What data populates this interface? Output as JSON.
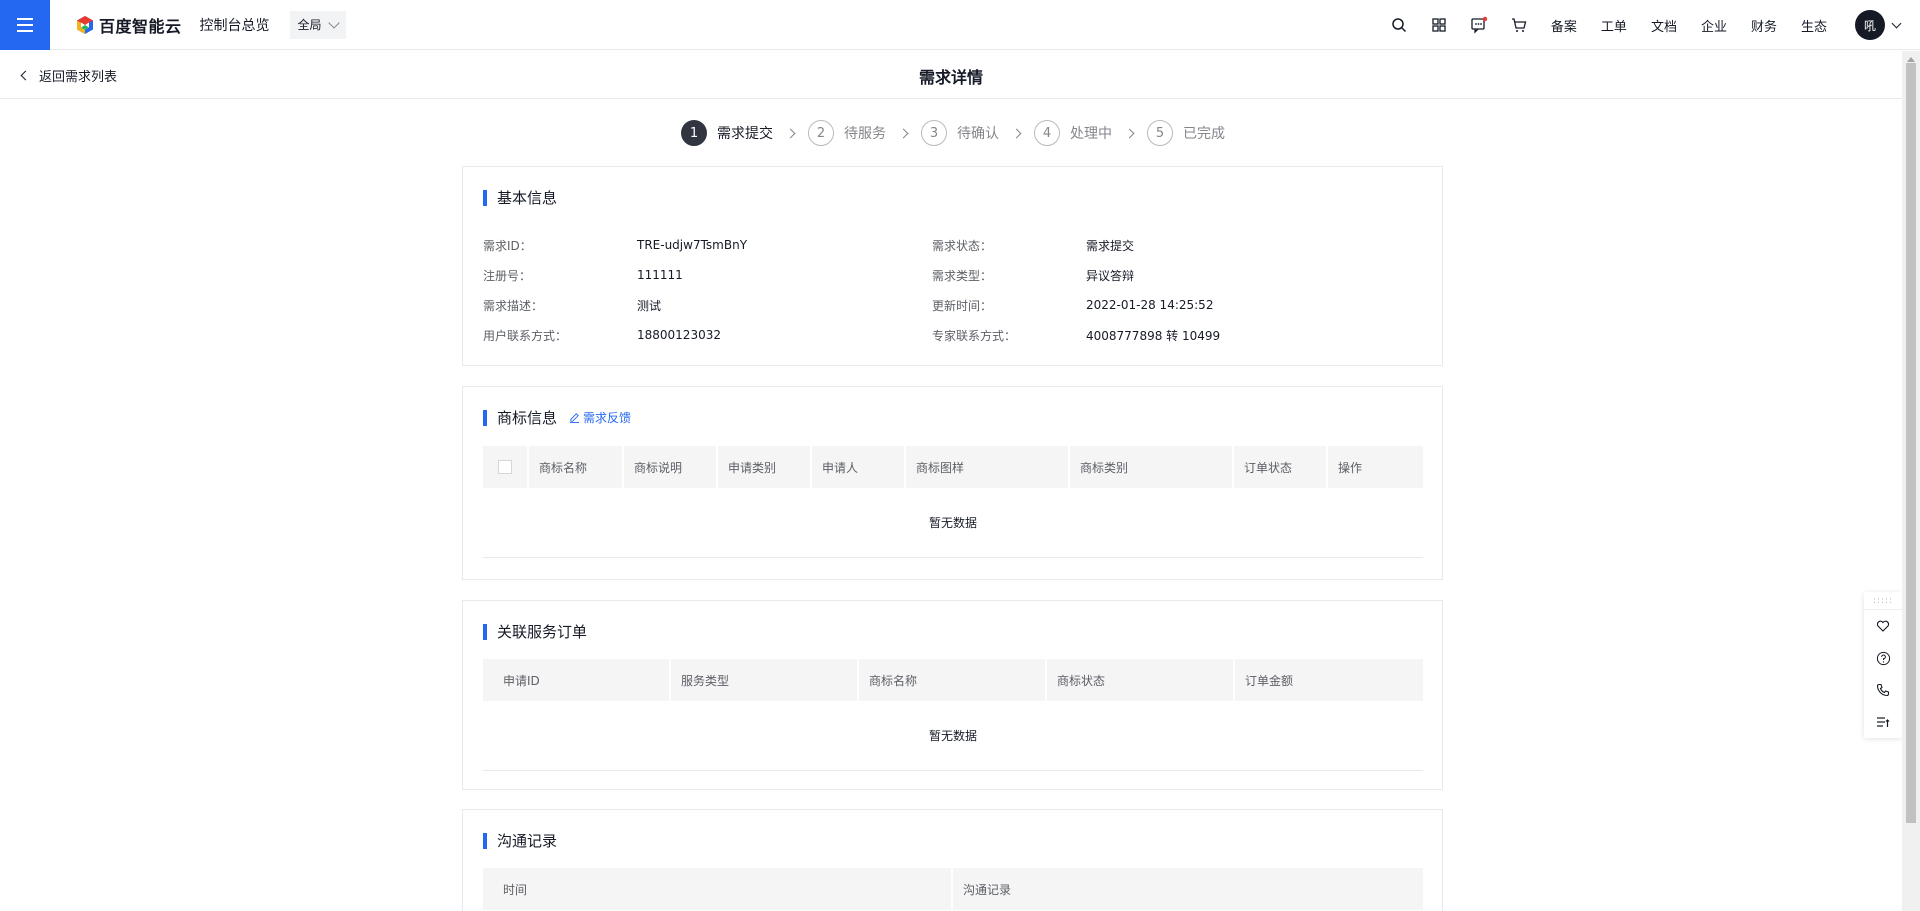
{
  "nav": {
    "logo_text": "百度智能云",
    "console": "控制台总览",
    "region": "全局",
    "links": [
      "备案",
      "工单",
      "文档",
      "企业",
      "财务",
      "生态"
    ],
    "avatar_text": "吼"
  },
  "subheader": {
    "back": "返回需求列表",
    "title": "需求详情"
  },
  "steps": [
    {
      "num": "1",
      "label": "需求提交"
    },
    {
      "num": "2",
      "label": "待服务"
    },
    {
      "num": "3",
      "label": "待确认"
    },
    {
      "num": "4",
      "label": "处理中"
    },
    {
      "num": "5",
      "label": "已完成"
    }
  ],
  "basic": {
    "title": "基本信息",
    "rows": [
      {
        "l1": "需求ID：",
        "v1": "TRE-udjw7TsmBnY",
        "l2": "需求状态：",
        "v2": "需求提交"
      },
      {
        "l1": "注册号：",
        "v1": "111111",
        "l2": "需求类型：",
        "v2": "异议答辩"
      },
      {
        "l1": "需求描述：",
        "v1": "测试",
        "l2": "更新时间：",
        "v2": "2022-01-28 14:25:52"
      },
      {
        "l1": "用户联系方式：",
        "v1": "18800123032",
        "l2": "专家联系方式：",
        "v2": "4008777898 转 10499"
      }
    ]
  },
  "trademark": {
    "title": "商标信息",
    "feedback": "需求反馈",
    "columns": [
      "商标名称",
      "商标说明",
      "申请类别",
      "申请人",
      "商标图样",
      "商标类别",
      "订单状态",
      "操作"
    ],
    "empty": "暂无数据"
  },
  "orders": {
    "title": "关联服务订单",
    "columns": [
      "申请ID",
      "服务类型",
      "商标名称",
      "商标状态",
      "订单金额"
    ],
    "empty": "暂无数据"
  },
  "comms": {
    "title": "沟通记录",
    "columns": [
      "时间",
      "沟通记录"
    ]
  },
  "colors": {
    "brand": "#2468f2",
    "active_step": "#303540"
  }
}
